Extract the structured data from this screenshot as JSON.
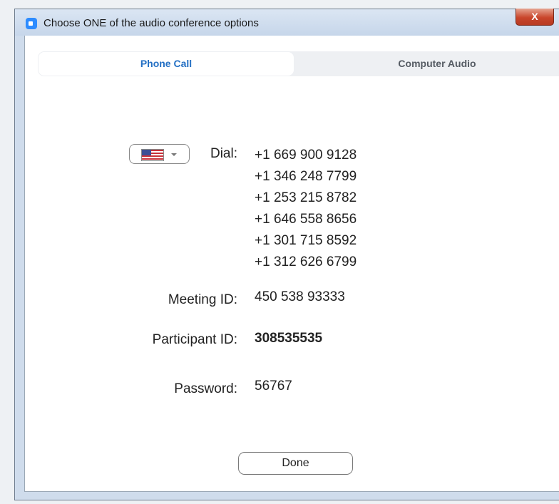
{
  "window": {
    "title": "Choose ONE of the audio conference options",
    "close_glyph": "X"
  },
  "tabs": [
    {
      "label": "Phone Call",
      "selected": true
    },
    {
      "label": "Computer Audio",
      "selected": false
    }
  ],
  "country": {
    "selected": "United States",
    "icon": "us-flag-icon"
  },
  "dial": {
    "label": "Dial:",
    "numbers": [
      "+1 669 900 9128",
      "+1 346 248 7799",
      "+1 253 215 8782",
      "+1 646 558 8656",
      "+1 301 715 8592",
      "+1 312 626 6799"
    ]
  },
  "meeting": {
    "label": "Meeting ID:",
    "value": "450 538 93333"
  },
  "participant": {
    "label": "Participant ID:",
    "value": "308535535"
  },
  "password": {
    "label": "Password:",
    "value": "56767"
  },
  "done_label": "Done",
  "colors": {
    "accent": "#2470c4",
    "app_icon": "#2d8cff",
    "close": "#c9462c"
  }
}
